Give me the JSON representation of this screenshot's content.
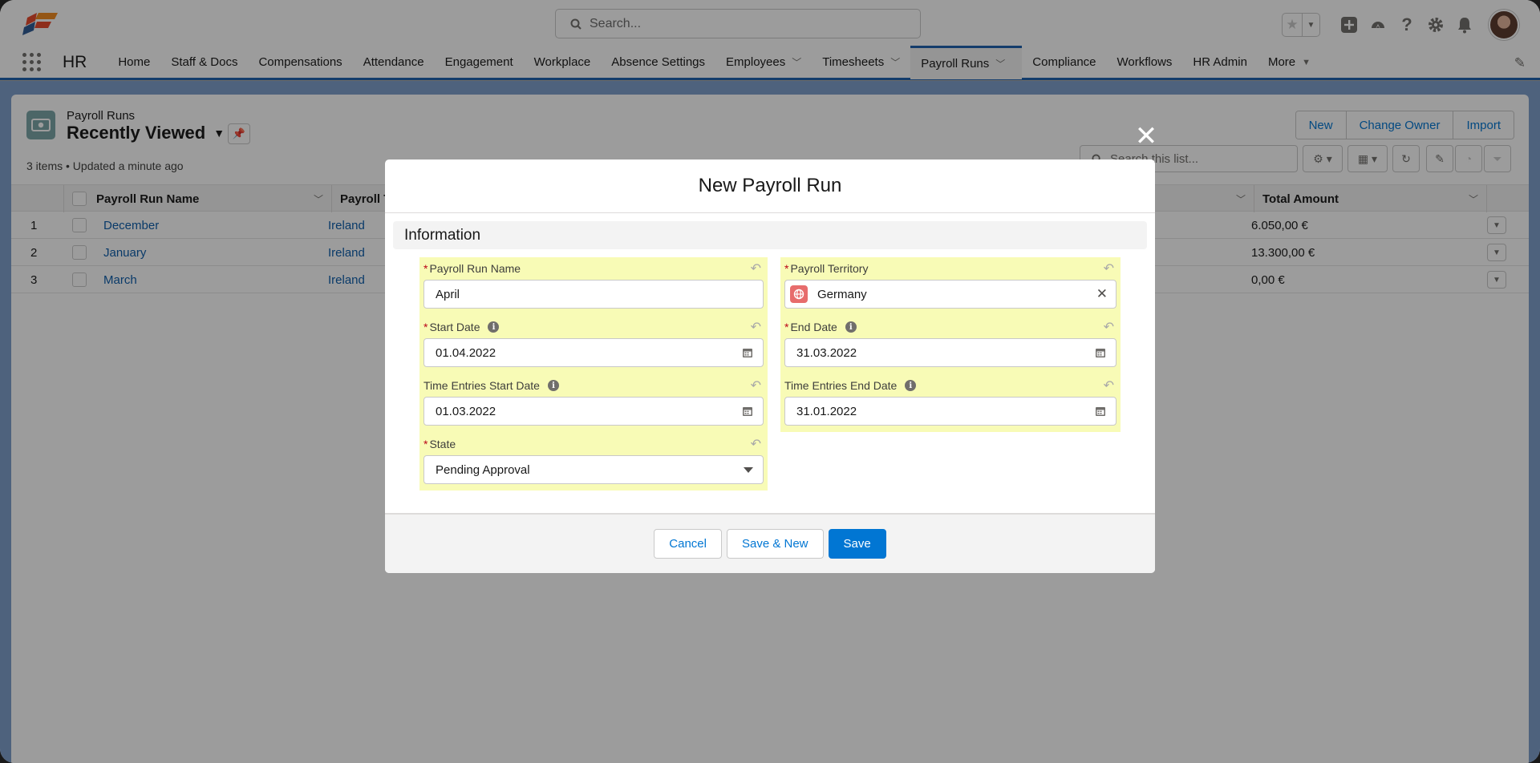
{
  "header": {
    "search_placeholder": "Search...",
    "icons": [
      "favorites-star-icon",
      "global-add-icon",
      "trailhead-icon",
      "help-icon",
      "setup-gear-icon",
      "notifications-bell-icon"
    ]
  },
  "nav": {
    "app_name": "HR",
    "items": [
      {
        "label": "Home"
      },
      {
        "label": "Staff & Docs"
      },
      {
        "label": "Compensations"
      },
      {
        "label": "Attendance"
      },
      {
        "label": "Engagement"
      },
      {
        "label": "Workplace"
      },
      {
        "label": "Absence Settings"
      },
      {
        "label": "Employees"
      },
      {
        "label": "Timesheets"
      },
      {
        "label": "Payroll Runs"
      },
      {
        "label": "Compliance"
      },
      {
        "label": "Workflows"
      },
      {
        "label": "HR Admin"
      },
      {
        "label": "More"
      }
    ]
  },
  "list_view": {
    "object_name": "Payroll Runs",
    "view_name": "Recently Viewed",
    "meta": "3 items • Updated a minute ago",
    "buttons": {
      "new": "New",
      "change_owner": "Change Owner",
      "import": "Import"
    },
    "search_placeholder": "Search this list...",
    "columns": {
      "name": "Payroll Run Name",
      "territory": "Payroll Te",
      "total": "Total Amount"
    },
    "rows": [
      {
        "num": "1",
        "name": "December",
        "territory": "Ireland",
        "total": "6.050,00 €"
      },
      {
        "num": "2",
        "name": "January",
        "territory": "Ireland",
        "total": "13.300,00 €"
      },
      {
        "num": "3",
        "name": "March",
        "territory": "Ireland",
        "total": "0,00 €"
      }
    ]
  },
  "modal": {
    "title": "New Payroll Run",
    "section": "Information",
    "required_mark": "*",
    "fields": {
      "payroll_run_name": {
        "label": "Payroll Run Name",
        "value": "April"
      },
      "payroll_territory": {
        "label": "Payroll Territory",
        "value": "Germany"
      },
      "start_date": {
        "label": "Start Date",
        "value": "01.04.2022"
      },
      "end_date": {
        "label": "End Date",
        "value": "31.03.2022"
      },
      "te_start_date": {
        "label": "Time Entries Start Date",
        "value": "01.03.2022"
      },
      "te_end_date": {
        "label": "Time Entries End Date",
        "value": "31.01.2022"
      },
      "state": {
        "label": "State",
        "value": "Pending Approval"
      }
    },
    "buttons": {
      "cancel": "Cancel",
      "save_new": "Save & New",
      "save": "Save"
    }
  },
  "colors": {
    "brand": "#0176d3",
    "highlight": "#f8fbb6",
    "required": "#ba0517"
  }
}
